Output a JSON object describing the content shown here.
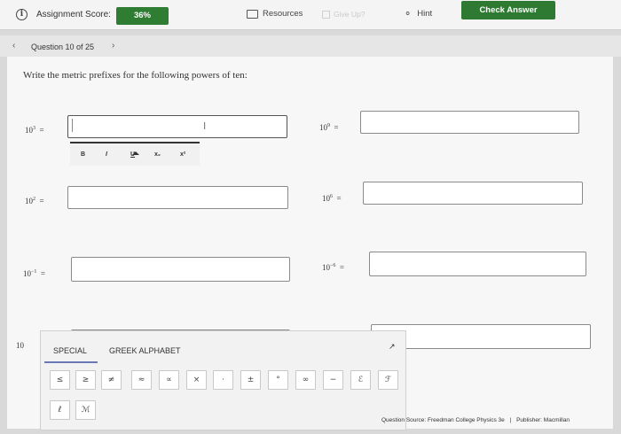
{
  "header": {
    "score_label": "Assignment Score:",
    "score_value": "36%",
    "resources_label": "Resources",
    "give_up_label": "Give Up?",
    "hint_label": "Hint",
    "check_answer_label": "Check Answer"
  },
  "nav": {
    "question_label": "Question 10 of 25",
    "prev_icon": "chevron-left-icon",
    "next_icon": "chevron-right-icon"
  },
  "question": {
    "prompt": "Write the metric prefixes for the following powers of ten:",
    "items": [
      {
        "base": "10",
        "exp": "3",
        "sign": "=",
        "value": ""
      },
      {
        "base": "10",
        "exp": "9",
        "sign": "=",
        "value": ""
      },
      {
        "base": "10",
        "exp": "2",
        "sign": "=",
        "value": ""
      },
      {
        "base": "10",
        "exp": "6",
        "sign": "=",
        "value": ""
      },
      {
        "base": "10",
        "exp": "−1",
        "sign": "=",
        "value": ""
      },
      {
        "base": "10",
        "exp": "−6",
        "sign": "=",
        "value": ""
      }
    ],
    "partial_label": "10"
  },
  "format_toolbar": {
    "bold": "B",
    "italic": "I",
    "underline": "U",
    "subscript": "x₂",
    "superscript": "x²"
  },
  "palette": {
    "tabs": [
      "SPECIAL",
      "GREEK ALPHABET"
    ],
    "active_tab": "SPECIAL",
    "symbols_row1": [
      "≤",
      "≥",
      "≠",
      "≈",
      "∝",
      "×",
      "·",
      "±",
      "°",
      "∞",
      "−",
      "ℰ",
      "ℱ"
    ],
    "symbols_row2": [
      "ℓ",
      "ℳ"
    ]
  },
  "footer": {
    "source": "Question Source: Freedman College Physics 3e",
    "separator": "|",
    "publisher": "Publisher: Macmillan"
  },
  "colors": {
    "score_badge": "#2e7d32",
    "check_answer": "#2f7a32",
    "tab_underline": "#6b78b5"
  }
}
